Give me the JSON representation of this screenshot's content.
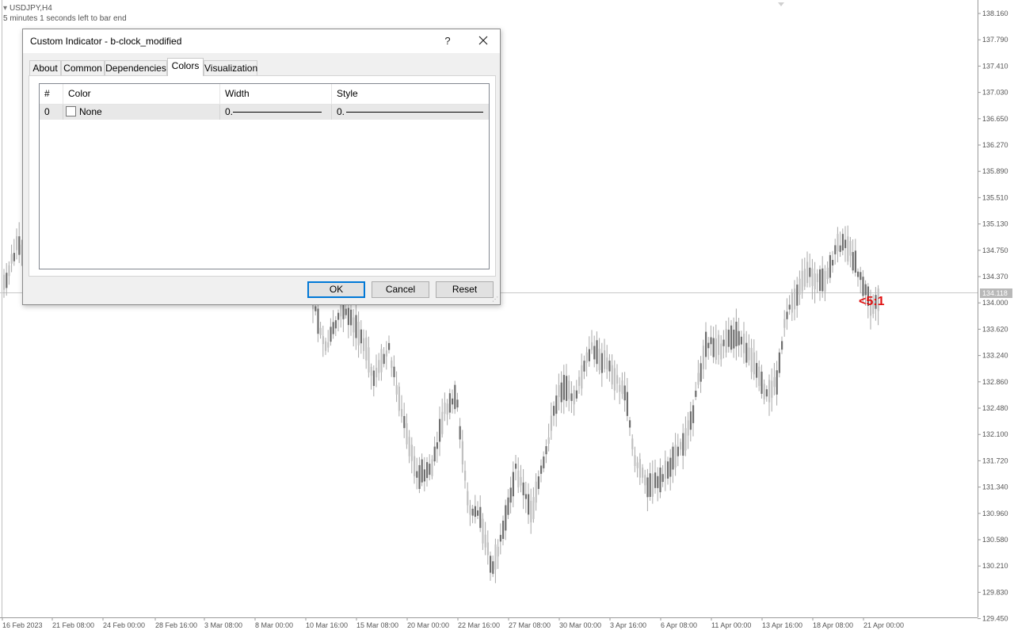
{
  "chart": {
    "symbol": "USDJPY,H4",
    "status_text": "5 minutes 1 seconds left to bar end",
    "current_price": "134.118",
    "clock_label": "<5:1",
    "price_ticks": [
      "138.160",
      "137.790",
      "137.410",
      "137.030",
      "136.650",
      "136.270",
      "135.890",
      "135.510",
      "135.130",
      "134.750",
      "134.370",
      "134.000",
      "133.620",
      "133.240",
      "132.860",
      "132.480",
      "132.100",
      "131.720",
      "131.340",
      "130.960",
      "130.580",
      "130.210",
      "129.830",
      "129.450"
    ],
    "time_ticks": [
      "16 Feb 2023",
      "21 Feb 08:00",
      "24 Feb 00:00",
      "28 Feb 16:00",
      "3 Mar 08:00",
      "8 Mar 00:00",
      "10 Mar 16:00",
      "15 Mar 08:00",
      "20 Mar 00:00",
      "22 Mar 16:00",
      "27 Mar 08:00",
      "30 Mar 00:00",
      "3 Apr 16:00",
      "6 Apr 08:00",
      "11 Apr 00:00",
      "13 Apr 16:00",
      "18 Apr 08:00",
      "21 Apr 00:00"
    ],
    "colors": {
      "bull": "#c0c0c0",
      "bear": "#6e6e6e",
      "wick": "#a8a8a8",
      "axis": "#9a9a9a",
      "text": "#555555",
      "clock": "#e01010"
    }
  },
  "dialog": {
    "title": "Custom Indicator - b-clock_modified",
    "help_label": "?",
    "close_icon": "close-icon",
    "tabs": [
      {
        "label": "About"
      },
      {
        "label": "Common"
      },
      {
        "label": "Dependencies"
      },
      {
        "label": "Colors"
      },
      {
        "label": "Visualization"
      }
    ],
    "active_tab": "Colors",
    "grid": {
      "columns": [
        "#",
        "Color",
        "Width",
        "Style"
      ],
      "rows": [
        {
          "index": "0",
          "color": "None",
          "width": "0.",
          "style": "0."
        }
      ]
    },
    "buttons": {
      "ok": "OK",
      "cancel": "Cancel",
      "reset": "Reset"
    }
  }
}
